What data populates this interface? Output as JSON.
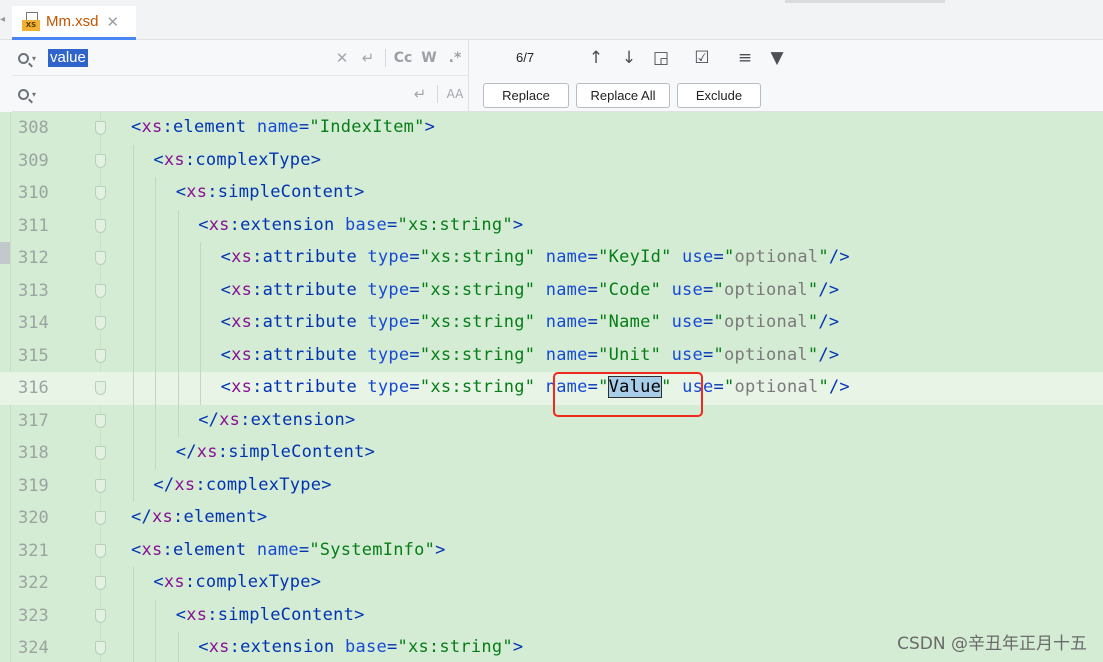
{
  "tab": {
    "file_name": "Mm.xsd",
    "close_glyph": "✕",
    "icon": "xsd-file-icon",
    "icon_badge": "XS"
  },
  "find": {
    "query": "value",
    "replace_value": "",
    "match_count": "6/7",
    "icons": {
      "clear": "✕",
      "multiline": "↵",
      "match_case": "Cc",
      "whole_words": "W",
      "regex": ".*",
      "preserve_case": "AA"
    }
  },
  "nav": {
    "prev": "↑",
    "next": "↓",
    "in_selection": "◲",
    "select_all": "☑",
    "filter_options": "≡",
    "filter": "▼"
  },
  "replace_buttons": {
    "replace": "Replace",
    "replace_all": "Replace All",
    "exclude": "Exclude"
  },
  "editor": {
    "lines": [
      {
        "num": "308",
        "indent": 0,
        "tokens": [
          [
            "br",
            "<"
          ],
          [
            "ns",
            "xs"
          ],
          [
            "tag",
            ":element "
          ],
          [
            "an",
            "name"
          ],
          [
            "eq",
            "="
          ],
          [
            "sv",
            "\"IndexItem\""
          ],
          [
            "br",
            ">"
          ]
        ]
      },
      {
        "num": "309",
        "indent": 1,
        "tokens": [
          [
            "br",
            "<"
          ],
          [
            "ns",
            "xs"
          ],
          [
            "tag",
            ":complexType"
          ],
          [
            "br",
            ">"
          ]
        ]
      },
      {
        "num": "310",
        "indent": 2,
        "tokens": [
          [
            "br",
            "<"
          ],
          [
            "ns",
            "xs"
          ],
          [
            "tag",
            ":simpleContent"
          ],
          [
            "br",
            ">"
          ]
        ]
      },
      {
        "num": "311",
        "indent": 3,
        "tokens": [
          [
            "br",
            "<"
          ],
          [
            "ns",
            "xs"
          ],
          [
            "tag",
            ":extension "
          ],
          [
            "an",
            "base"
          ],
          [
            "eq",
            "="
          ],
          [
            "sv",
            "\"xs:string\""
          ],
          [
            "br",
            ">"
          ]
        ]
      },
      {
        "num": "312",
        "indent": 4,
        "tokens": [
          [
            "br",
            "<"
          ],
          [
            "ns",
            "xs"
          ],
          [
            "tag",
            ":attribute "
          ],
          [
            "an",
            "type"
          ],
          [
            "eq",
            "="
          ],
          [
            "sv",
            "\"xs:string\" "
          ],
          [
            "an",
            "name"
          ],
          [
            "eq",
            "="
          ],
          [
            "sv",
            "\"KeyId\" "
          ],
          [
            "an",
            "use"
          ],
          [
            "eq",
            "="
          ],
          [
            "sv",
            "\""
          ],
          [
            "sg",
            "optional"
          ],
          [
            "sv",
            "\""
          ],
          [
            "br",
            "/>"
          ]
        ]
      },
      {
        "num": "313",
        "indent": 4,
        "tokens": [
          [
            "br",
            "<"
          ],
          [
            "ns",
            "xs"
          ],
          [
            "tag",
            ":attribute "
          ],
          [
            "an",
            "type"
          ],
          [
            "eq",
            "="
          ],
          [
            "sv",
            "\"xs:string\" "
          ],
          [
            "an",
            "name"
          ],
          [
            "eq",
            "="
          ],
          [
            "sv",
            "\"Code\" "
          ],
          [
            "an",
            "use"
          ],
          [
            "eq",
            "="
          ],
          [
            "sv",
            "\""
          ],
          [
            "sg",
            "optional"
          ],
          [
            "sv",
            "\""
          ],
          [
            "br",
            "/>"
          ]
        ]
      },
      {
        "num": "314",
        "indent": 4,
        "tokens": [
          [
            "br",
            "<"
          ],
          [
            "ns",
            "xs"
          ],
          [
            "tag",
            ":attribute "
          ],
          [
            "an",
            "type"
          ],
          [
            "eq",
            "="
          ],
          [
            "sv",
            "\"xs:string\" "
          ],
          [
            "an",
            "name"
          ],
          [
            "eq",
            "="
          ],
          [
            "sv",
            "\"Name\" "
          ],
          [
            "an",
            "use"
          ],
          [
            "eq",
            "="
          ],
          [
            "sv",
            "\""
          ],
          [
            "sg",
            "optional"
          ],
          [
            "sv",
            "\""
          ],
          [
            "br",
            "/>"
          ]
        ]
      },
      {
        "num": "315",
        "indent": 4,
        "tokens": [
          [
            "br",
            "<"
          ],
          [
            "ns",
            "xs"
          ],
          [
            "tag",
            ":attribute "
          ],
          [
            "an",
            "type"
          ],
          [
            "eq",
            "="
          ],
          [
            "sv",
            "\"xs:string\" "
          ],
          [
            "an",
            "name"
          ],
          [
            "eq",
            "="
          ],
          [
            "sv",
            "\"Unit\" "
          ],
          [
            "an",
            "use"
          ],
          [
            "eq",
            "="
          ],
          [
            "sv",
            "\""
          ],
          [
            "sg",
            "optional"
          ],
          [
            "sv",
            "\""
          ],
          [
            "br",
            "/>"
          ]
        ]
      },
      {
        "num": "316",
        "indent": 4,
        "current": true,
        "tokens": [
          [
            "br",
            "<"
          ],
          [
            "ns",
            "xs"
          ],
          [
            "tag",
            ":attribute "
          ],
          [
            "an",
            "type"
          ],
          [
            "eq",
            "="
          ],
          [
            "sv",
            "\"xs:string\" "
          ],
          [
            "an",
            "name"
          ],
          [
            "eq",
            "="
          ],
          [
            "sv",
            "\""
          ],
          [
            "hl",
            "Value"
          ],
          [
            "sv",
            "\" "
          ],
          [
            "an",
            "use"
          ],
          [
            "eq",
            "="
          ],
          [
            "sv",
            "\""
          ],
          [
            "sg",
            "optional"
          ],
          [
            "sv",
            "\""
          ],
          [
            "br",
            "/>"
          ]
        ]
      },
      {
        "num": "317",
        "indent": 3,
        "tokens": [
          [
            "br",
            "</"
          ],
          [
            "ns",
            "xs"
          ],
          [
            "tag",
            ":extension"
          ],
          [
            "br",
            ">"
          ]
        ]
      },
      {
        "num": "318",
        "indent": 2,
        "tokens": [
          [
            "br",
            "</"
          ],
          [
            "ns",
            "xs"
          ],
          [
            "tag",
            ":simpleContent"
          ],
          [
            "br",
            ">"
          ]
        ]
      },
      {
        "num": "319",
        "indent": 1,
        "tokens": [
          [
            "br",
            "</"
          ],
          [
            "ns",
            "xs"
          ],
          [
            "tag",
            ":complexType"
          ],
          [
            "br",
            ">"
          ]
        ]
      },
      {
        "num": "320",
        "indent": 0,
        "tokens": [
          [
            "br",
            "</"
          ],
          [
            "ns",
            "xs"
          ],
          [
            "tag",
            ":element"
          ],
          [
            "br",
            ">"
          ]
        ]
      },
      {
        "num": "321",
        "indent": 0,
        "tokens": [
          [
            "br",
            "<"
          ],
          [
            "ns",
            "xs"
          ],
          [
            "tag",
            ":element "
          ],
          [
            "an",
            "name"
          ],
          [
            "eq",
            "="
          ],
          [
            "sv",
            "\"SystemInfo\""
          ],
          [
            "br",
            ">"
          ]
        ]
      },
      {
        "num": "322",
        "indent": 1,
        "tokens": [
          [
            "br",
            "<"
          ],
          [
            "ns",
            "xs"
          ],
          [
            "tag",
            ":complexType"
          ],
          [
            "br",
            ">"
          ]
        ]
      },
      {
        "num": "323",
        "indent": 2,
        "tokens": [
          [
            "br",
            "<"
          ],
          [
            "ns",
            "xs"
          ],
          [
            "tag",
            ":simpleContent"
          ],
          [
            "br",
            ">"
          ]
        ]
      },
      {
        "num": "324",
        "indent": 3,
        "tokens": [
          [
            "br",
            "<"
          ],
          [
            "ns",
            "xs"
          ],
          [
            "tag",
            ":extension "
          ],
          [
            "an",
            "base"
          ],
          [
            "eq",
            "="
          ],
          [
            "sv",
            "\"xs:string\""
          ],
          [
            "br",
            ">"
          ]
        ]
      }
    ]
  },
  "watermark": "CSDN @辛丑年正月十五",
  "colors": {
    "editor_bg": "#d4ecd4",
    "current_line": "#e8f4e6",
    "annotation_box": "#ee2a1e",
    "search_highlight": "#a8cde8",
    "tab_accent": "#4a86f7"
  }
}
